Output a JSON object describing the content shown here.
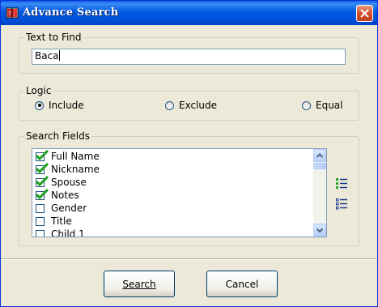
{
  "window": {
    "title": "Advance Search",
    "app_icon": "book-icon",
    "close_icon": "close-icon"
  },
  "text_to_find": {
    "legend": "Text to Find",
    "value": "Baca"
  },
  "logic": {
    "legend": "Logic",
    "options": [
      {
        "label": "Include",
        "selected": true
      },
      {
        "label": "Exclude",
        "selected": false
      },
      {
        "label": "Equal",
        "selected": false
      }
    ]
  },
  "search_fields": {
    "legend": "Search Fields",
    "items": [
      {
        "label": "Full Name",
        "checked": true
      },
      {
        "label": "Nickname",
        "checked": true
      },
      {
        "label": "Spouse",
        "checked": true
      },
      {
        "label": "Notes",
        "checked": true
      },
      {
        "label": "Gender",
        "checked": false
      },
      {
        "label": "Title",
        "checked": false
      },
      {
        "label": "Child 1",
        "checked": false
      }
    ],
    "side_icons": [
      "check-all-icon",
      "uncheck-all-icon"
    ]
  },
  "buttons": {
    "search": "Search",
    "cancel": "Cancel"
  },
  "colors": {
    "titlebar": "#0054e3",
    "dialog_bg": "#ece9d8",
    "check": "#21a121"
  }
}
